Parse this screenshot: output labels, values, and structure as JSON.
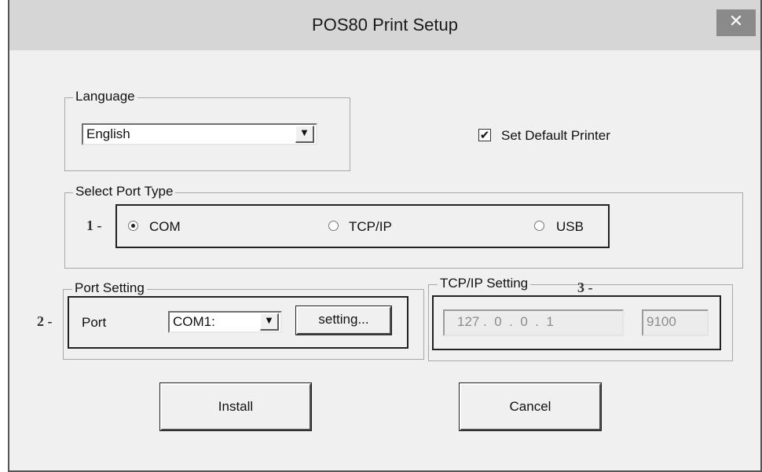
{
  "window": {
    "title": "POS80 Print Setup",
    "close_glyph": "✕"
  },
  "language": {
    "group_label": "Language",
    "selected": "English",
    "dropdown_glyph": "▼"
  },
  "default_printer": {
    "label": "Set Default Printer",
    "checked": true,
    "check_glyph": "✔"
  },
  "port_type": {
    "group_label": "Select Port Type",
    "marker": "1 -",
    "options": [
      {
        "label": "COM",
        "selected": true
      },
      {
        "label": "TCP/IP",
        "selected": false
      },
      {
        "label": "USB",
        "selected": false
      }
    ]
  },
  "port_setting": {
    "group_label": "Port Setting",
    "marker": "2 -",
    "port_label": "Port",
    "port_value": "COM1:",
    "dropdown_glyph": "▼",
    "setting_button": "setting..."
  },
  "tcpip_setting": {
    "group_label": "TCP/IP Setting",
    "marker": "3 -",
    "ip_display": "127 .  0  .  0  .  1",
    "port_number": "9100"
  },
  "buttons": {
    "install": "Install",
    "cancel": "Cancel"
  }
}
